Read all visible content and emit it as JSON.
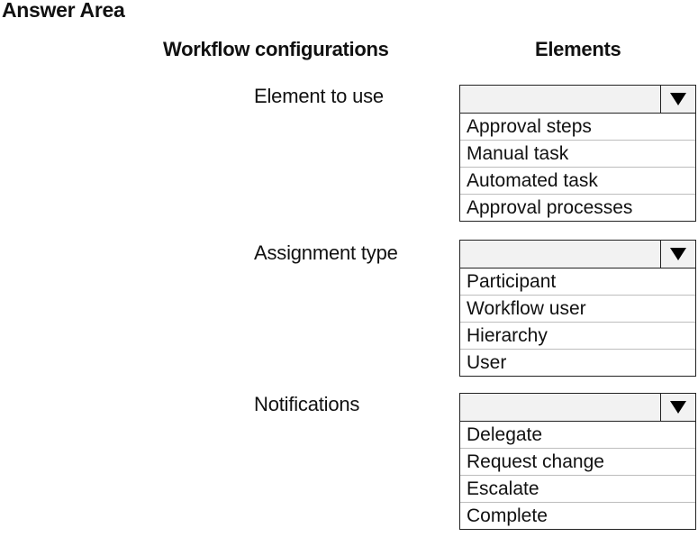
{
  "title": "Answer Area",
  "headers": {
    "left": "Workflow configurations",
    "right": "Elements"
  },
  "rows": [
    {
      "label": "Element to use",
      "selected": "",
      "dropdown_icon": "triangle-down-icon",
      "options": [
        "Approval steps",
        "Manual task",
        "Automated task",
        "Approval processes"
      ]
    },
    {
      "label": "Assignment type",
      "selected": "",
      "dropdown_icon": "triangle-down-icon",
      "options": [
        "Participant",
        "Workflow user",
        "Hierarchy",
        "User"
      ]
    },
    {
      "label": "Notifications",
      "selected": "",
      "dropdown_icon": "triangle-down-icon",
      "options": [
        "Delegate",
        "Request change",
        "Escalate",
        "Complete"
      ]
    }
  ],
  "colors": {
    "dropdown_header_bg": "#f2f2f2",
    "border": "#222222",
    "option_divider": "#bdbdbd",
    "text": "#111111"
  }
}
